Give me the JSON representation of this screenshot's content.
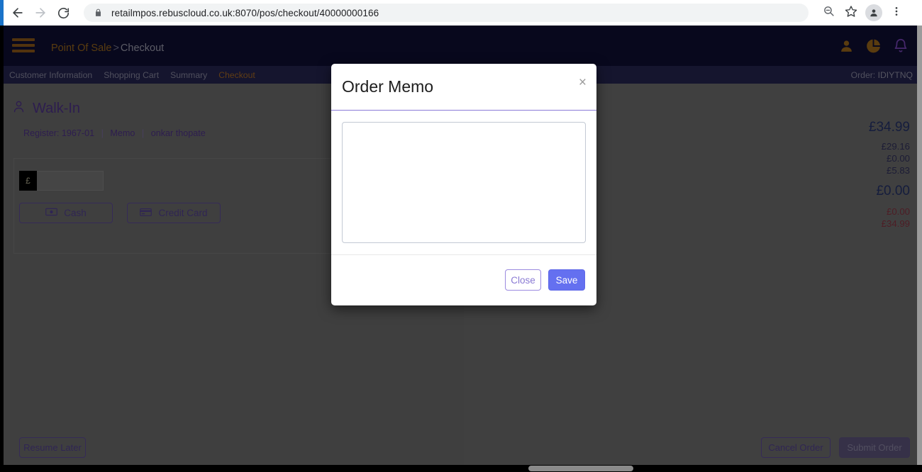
{
  "browser": {
    "back_icon": "back-arrow-icon",
    "forward_icon": "forward-arrow-icon",
    "reload_icon": "reload-icon",
    "lock_icon": "lock-icon",
    "url_host": "retailmpos.rebuscloud.co.uk",
    "url_path": ":8070/pos/checkout/40000000166",
    "url_full": "retailmpos.rebuscloud.co.uk:8070/pos/checkout/40000000166",
    "zoom_out_icon": "zoom-out-icon",
    "bookmark_icon": "star-icon",
    "profile_icon": "profile-avatar-icon",
    "menu_icon": "three-dot-menu-icon"
  },
  "header": {
    "menu_icon": "hamburger-menu-icon",
    "breadcrumb_root": "Point Of Sale",
    "breadcrumb_separator": ">",
    "breadcrumb_current": "Checkout",
    "icons": [
      {
        "name": "user-account-icon",
        "color": "#b4791f"
      },
      {
        "name": "reports-pie-chart-icon",
        "color": "#b4791f"
      },
      {
        "name": "notifications-bell-icon",
        "color": "#8a4fd6"
      }
    ]
  },
  "steps": {
    "items": [
      {
        "label": "Customer Information",
        "active": false
      },
      {
        "label": "Shopping Cart",
        "active": false
      },
      {
        "label": "Summary",
        "active": false
      },
      {
        "label": "Checkout",
        "active": true
      }
    ],
    "order_label": "Order:",
    "order_value": "IDIYTNQ"
  },
  "customer": {
    "icon": "customer-person-icon",
    "name": "Walk-In",
    "register_label": "Register:",
    "register_value": "1967-01",
    "memo_link": "Memo",
    "cashier_link": "onkar thopate",
    "separator": "|"
  },
  "payment": {
    "currency_prefix": "£",
    "amount_value": "",
    "amount_placeholder": "",
    "cash_label": "Cash",
    "cash_icon": "banknote-icon",
    "card_label": "Credit Card",
    "card_icon": "credit-card-icon"
  },
  "totals": {
    "grand_total": "£34.99",
    "lines": [
      "£29.16",
      "£0.00",
      "£5.83"
    ],
    "amount_due": "£0.00",
    "red_lines": [
      "£0.00",
      "£34.99"
    ]
  },
  "footer": {
    "resume_label": "Resume Later",
    "cancel_label": "Cancel Order",
    "submit_label": "Submit Order"
  },
  "modal": {
    "title": "Order Memo",
    "close_icon": "close-x-icon",
    "memo_value": "",
    "memo_placeholder": "",
    "close_label": "Close",
    "save_label": "Save"
  },
  "colors": {
    "header_bg": "#10103a",
    "stepnav_bg": "#2a2a5c",
    "accent_orange": "#b4791f",
    "accent_purple": "#5b3a9e",
    "save_blue": "#6470f0",
    "red_total": "#9b3b4a",
    "page_bg": "#7f7f7f"
  }
}
